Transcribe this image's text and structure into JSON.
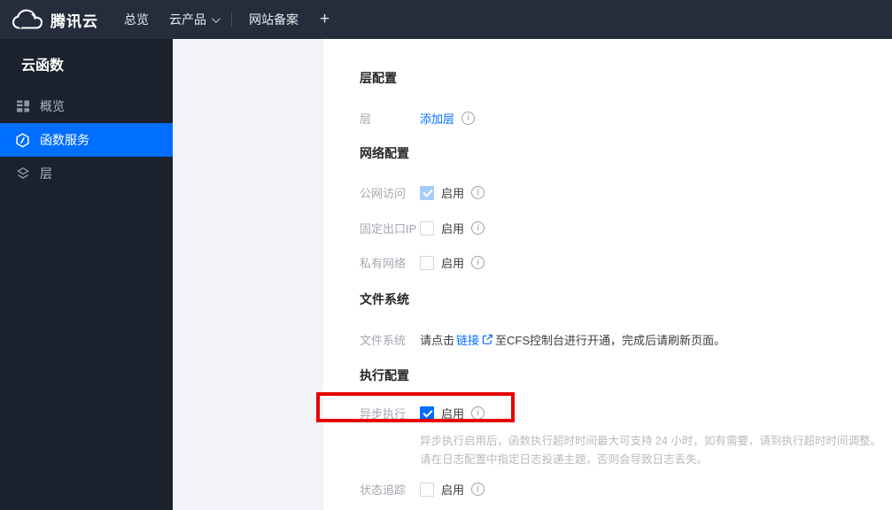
{
  "topbar": {
    "brand": "腾讯云",
    "nav_overview": "总览",
    "nav_products": "云产品",
    "nav_beian": "网站备案",
    "nav_add": "+"
  },
  "sidebar": {
    "title": "云函数",
    "item_overview": "概览",
    "item_functions": "函数服务",
    "item_layers": "层"
  },
  "form": {
    "section_layer": "层配置",
    "row_layer": {
      "label": "层",
      "link": "添加层"
    },
    "section_network": "网络配置",
    "row_public_access": {
      "label": "公网访问",
      "enable": "启用"
    },
    "row_fixed_ip": {
      "label": "固定出口IP",
      "enable": "启用"
    },
    "row_vpc": {
      "label": "私有网络",
      "enable": "启用"
    },
    "section_filesystem": "文件系统",
    "row_filesystem": {
      "label": "文件系统",
      "text_before": "请点击",
      "link": "链接",
      "text_after": "至CFS控制台进行开通，完成后请刷新页面。"
    },
    "section_execution": "执行配置",
    "row_async": {
      "label": "异步执行",
      "enable": "启用"
    },
    "async_note_line1": "异步执行启用后，函数执行超时时间最大可支持 24 小时，如有需要，请到执行超时时间调整。",
    "async_note_line2": "请在日志配置中指定日志投递主题，否则会导致日志丢失。",
    "row_trace": {
      "label": "状态追踪",
      "enable": "启用"
    }
  },
  "checkboxes": {
    "public_access": {
      "checked": true,
      "disabled": true
    },
    "fixed_ip": {
      "checked": false,
      "disabled": false
    },
    "vpc": {
      "checked": false,
      "disabled": false
    },
    "async_exec": {
      "checked": true,
      "disabled": false
    },
    "status_trace": {
      "checked": false,
      "disabled": false
    }
  },
  "colors": {
    "accent": "#006eff",
    "annotation": "#e60000",
    "topbar_bg": "#252d3c",
    "sidebar_bg": "#1b212d",
    "checkbox_disabled_checked": "#a6cdf7"
  }
}
